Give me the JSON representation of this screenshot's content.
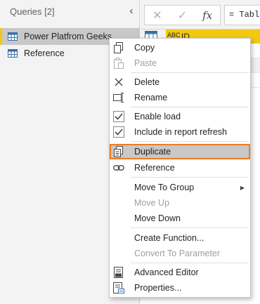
{
  "queries": {
    "header": "Queries [2]",
    "items": [
      {
        "label": "Power Platfrom Geeks",
        "selected": true
      },
      {
        "label": "Reference",
        "selected": false
      }
    ]
  },
  "formula_bar": {
    "text": "= Table"
  },
  "grid": {
    "column_type": "ABC",
    "column_label": "ID"
  },
  "context_menu": {
    "items": [
      {
        "label": "Copy",
        "icon": "copy-icon",
        "enabled": true
      },
      {
        "label": "Paste",
        "icon": "paste-icon",
        "enabled": false
      },
      {
        "label": "Delete",
        "icon": "delete-icon",
        "enabled": true
      },
      {
        "label": "Rename",
        "icon": "rename-icon",
        "enabled": true
      },
      {
        "label": "Enable load",
        "icon": "checkbox-icon",
        "enabled": true,
        "checked": true
      },
      {
        "label": "Include in report refresh",
        "icon": "checkbox-icon",
        "enabled": true,
        "checked": true
      },
      {
        "label": "Duplicate",
        "icon": "duplicate-icon",
        "enabled": true,
        "highlighted": true
      },
      {
        "label": "Reference",
        "icon": "reference-icon",
        "enabled": true
      },
      {
        "label": "Move To Group",
        "icon": "",
        "enabled": true,
        "submenu": true
      },
      {
        "label": "Move Up",
        "icon": "",
        "enabled": false
      },
      {
        "label": "Move Down",
        "icon": "",
        "enabled": true
      },
      {
        "label": "Create Function...",
        "icon": "",
        "enabled": true
      },
      {
        "label": "Convert To Parameter",
        "icon": "",
        "enabled": false
      },
      {
        "label": "Advanced Editor",
        "icon": "advanced-editor-icon",
        "enabled": true
      },
      {
        "label": "Properties...",
        "icon": "properties-icon",
        "enabled": true
      }
    ]
  },
  "colors": {
    "accent_yellow": "#f2c811",
    "highlight_border": "#ec7b23",
    "selected_bg": "#c8c8c8"
  }
}
